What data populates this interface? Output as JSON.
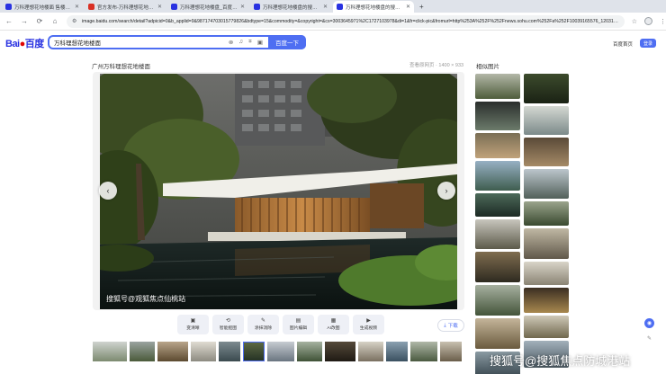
{
  "browser": {
    "tabs": [
      {
        "label": "万科理想花地楼面 售楼处地址_百",
        "favicon": "baidu",
        "active": false
      },
      {
        "label": "官方发布-万科理想花地楼盘上海...",
        "favicon": "red",
        "active": false
      },
      {
        "label": "万科理想花地楼盘_百度图片",
        "favicon": "baidu",
        "active": false
      },
      {
        "label": "万科理想花地楼盘的搜索结果_百度",
        "favicon": "baidu",
        "active": false
      },
      {
        "label": "万科理想花地楼盘的搜索结果_百度",
        "favicon": "baidu",
        "active": true
      }
    ],
    "new_tab": "+",
    "url": "image.baidu.com/search/detail?adpicid=0&b_applid=9&987174703015779826&bdtype=15&commodity=&copyright=&cs=3003645971%2C1727103978&di=1&fr=click-pic&fromurl=http%253A%252F%252Fnews.sohu.com%252Fa%252F10039165576_120316..."
  },
  "header": {
    "logo_left": "Bai",
    "logo_right": "百度",
    "search_value": "万科理想花地楼面",
    "search_button": "百度一下",
    "home_link": "百度首页",
    "login": "登录"
  },
  "viewer": {
    "title": "广州万科理想花地楼面",
    "meta": "查看原网页 · 1400 × 933",
    "watermark": "搜狐号@观狐焦点仙桃站"
  },
  "tools": [
    {
      "icon": "▣",
      "label": "变清晰"
    },
    {
      "icon": "⟲",
      "label": "智能抠图"
    },
    {
      "icon": "✎",
      "label": "涂抹消除"
    },
    {
      "icon": "▤",
      "label": "图片编辑"
    },
    {
      "icon": "▦",
      "label": "AI改图"
    },
    {
      "icon": "▶",
      "label": "生成视频"
    }
  ],
  "download_label": "下载",
  "related_title": "相似图片",
  "bottom_watermark": "搜狐号@搜狐焦点防城港站"
}
